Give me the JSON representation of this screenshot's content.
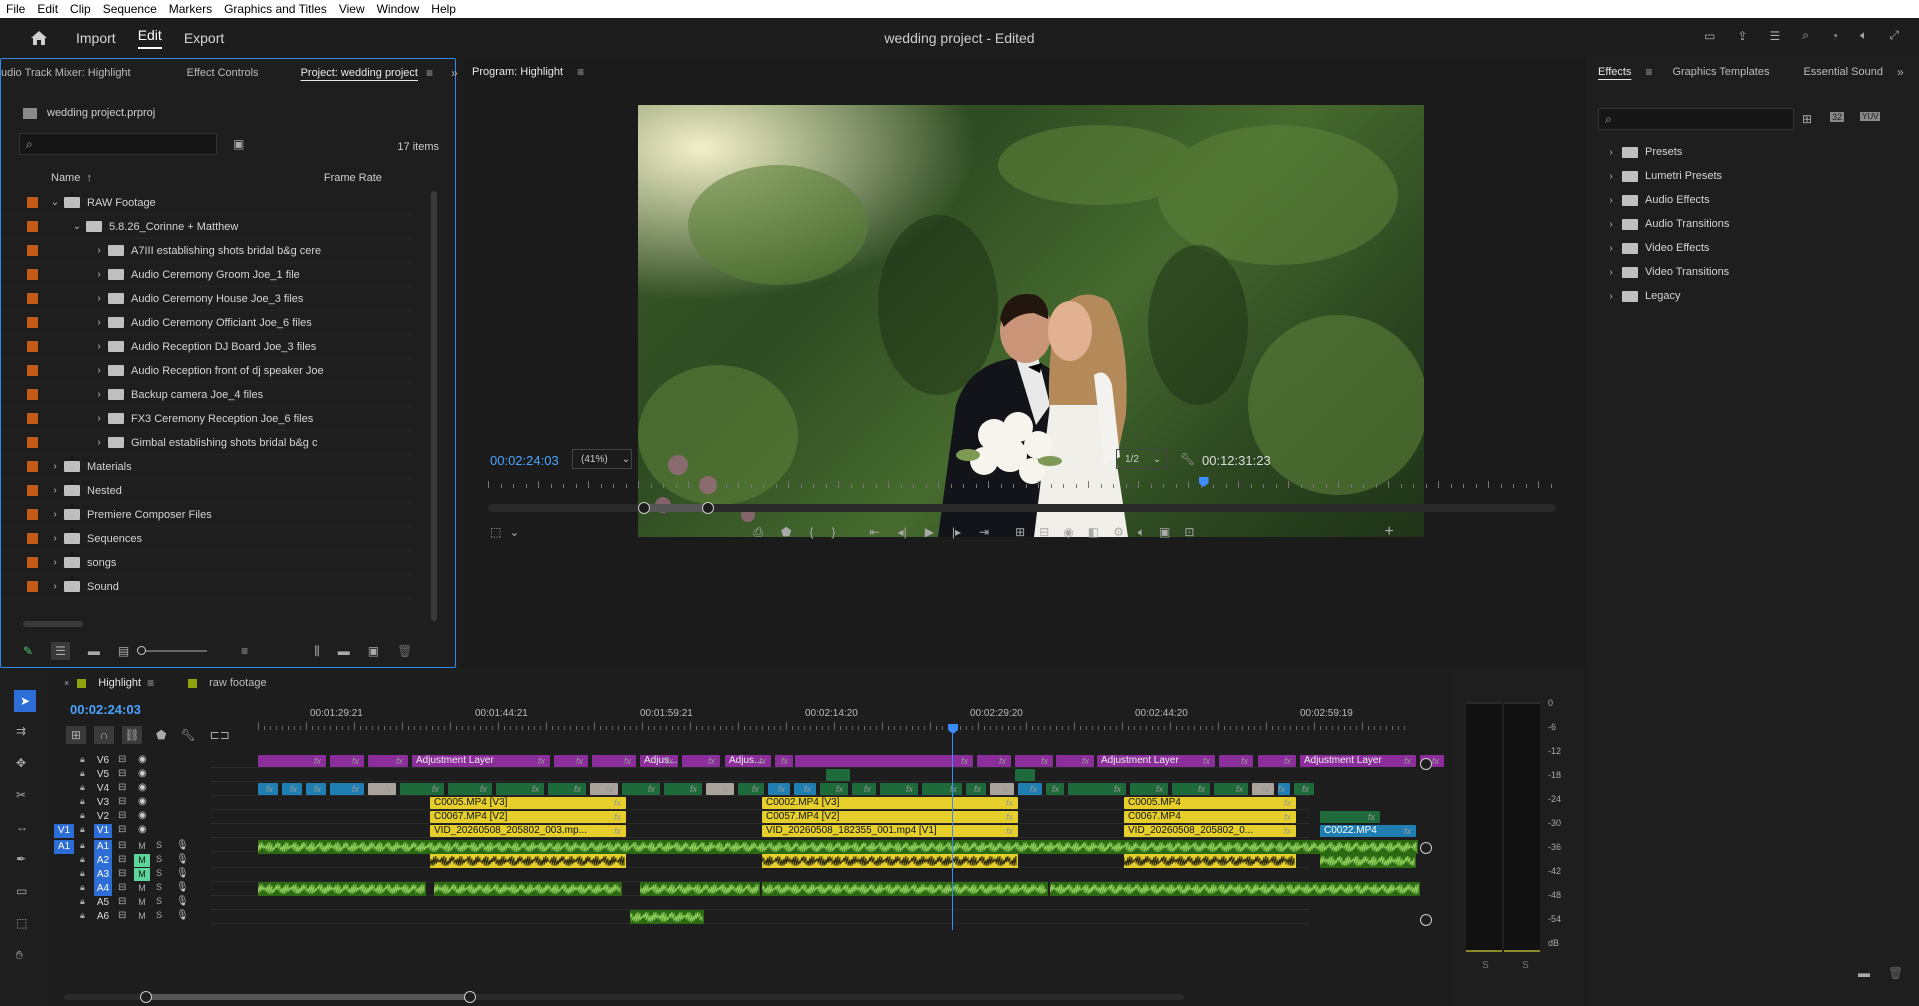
{
  "menu": [
    "File",
    "Edit",
    "Clip",
    "Sequence",
    "Markers",
    "Graphics and Titles",
    "View",
    "Window",
    "Help"
  ],
  "appbar": {
    "nav": [
      "Import",
      "Edit",
      "Export"
    ],
    "active": "Edit",
    "title": "wedding project - Edited"
  },
  "project_panel": {
    "tabs": [
      "udio Track Mixer: Highlight",
      "Effect Controls",
      "Project: wedding project"
    ],
    "active_tab": "Project: wedding project",
    "file": "wedding project.prproj",
    "item_count": "17 items",
    "col_name": "Name",
    "col_rate": "Frame Rate",
    "rows": [
      {
        "level": 0,
        "open": true,
        "label": "RAW Footage"
      },
      {
        "level": 1,
        "open": true,
        "label": "5.8.26_Corinne + Matthew"
      },
      {
        "level": 2,
        "open": false,
        "label": "A7III establishing shots bridal b&g cere"
      },
      {
        "level": 2,
        "open": false,
        "label": "Audio Ceremony Groom Joe_1 file"
      },
      {
        "level": 2,
        "open": false,
        "label": "Audio Ceremony House Joe_3 files"
      },
      {
        "level": 2,
        "open": false,
        "label": "Audio Ceremony Officiant Joe_6 files"
      },
      {
        "level": 2,
        "open": false,
        "label": "Audio Reception DJ Board Joe_3 files"
      },
      {
        "level": 2,
        "open": false,
        "label": "Audio Reception front of dj speaker Joe"
      },
      {
        "level": 2,
        "open": false,
        "label": "Backup camera Joe_4 files"
      },
      {
        "level": 2,
        "open": false,
        "label": "FX3 Ceremony Reception Joe_6 files"
      },
      {
        "level": 2,
        "open": false,
        "label": "Gimbal establishing shots bridal b&g c"
      },
      {
        "level": 0,
        "open": false,
        "label": "Materials"
      },
      {
        "level": 0,
        "open": false,
        "label": "Nested"
      },
      {
        "level": 0,
        "open": false,
        "label": "Premiere Composer Files"
      },
      {
        "level": 0,
        "open": false,
        "label": "Sequences"
      },
      {
        "level": 0,
        "open": false,
        "label": "songs"
      },
      {
        "level": 0,
        "open": false,
        "label": "Sound"
      }
    ]
  },
  "program": {
    "title": "Program: Highlight",
    "timecode": "00:02:24:03",
    "zoom": "(41%)",
    "resolution": "1/2",
    "duration": "00:12:31:23",
    "playhead_fraction": 0.67
  },
  "effects_panel": {
    "tabs": [
      "Effects",
      "Graphics Templates",
      "Essential Sound"
    ],
    "active_tab": "Effects",
    "badges": [
      "32",
      "YUV"
    ],
    "items": [
      "Presets",
      "Lumetri Presets",
      "Audio Effects",
      "Audio Transitions",
      "Video Effects",
      "Video Transitions",
      "Legacy"
    ]
  },
  "timeline": {
    "tabs": [
      "Highlight",
      "raw footage"
    ],
    "active_tab": "Highlight",
    "timecode": "00:02:24:03",
    "ruler": [
      "00:01:29:21",
      "00:01:44:21",
      "00:01:59:21",
      "00:02:14:20",
      "00:02:29:20",
      "00:02:44:20",
      "00:02:59:19"
    ],
    "video_tracks": [
      "V6",
      "V5",
      "V4",
      "V3",
      "V2",
      "V1"
    ],
    "audio_tracks": [
      "A1",
      "A2",
      "A3",
      "A4",
      "A5",
      "A6"
    ],
    "src_v": "V1",
    "src_a": "A1",
    "fx": "fx",
    "mute": "M",
    "solo": "S",
    "clips": {
      "adj": "Adjustment Layer",
      "adj_short": "Adjus...",
      "v3a": "C0005.MP4 [V3]",
      "v2a": "C0067.MP4 [V2]",
      "v1a": "VID_20260508_205802_003.mp...",
      "v3b": "C0002.MP4 [V3]",
      "v2b": "C0057.MP4 [V2]",
      "v1b": "VID_20260508_182355_001.mp4 [V1]",
      "v3c": "C0005.MP4",
      "v2c": "C0067.MP4",
      "v1c": "VID_20260508_205802_0...",
      "v1d": "C0022.MP4"
    }
  },
  "meter": {
    "scale": [
      "0",
      "-6",
      "-12",
      "-18",
      "-24",
      "-30",
      "-36",
      "-42",
      "-48",
      "-54",
      "dB"
    ],
    "solo": [
      "S",
      "S"
    ]
  }
}
